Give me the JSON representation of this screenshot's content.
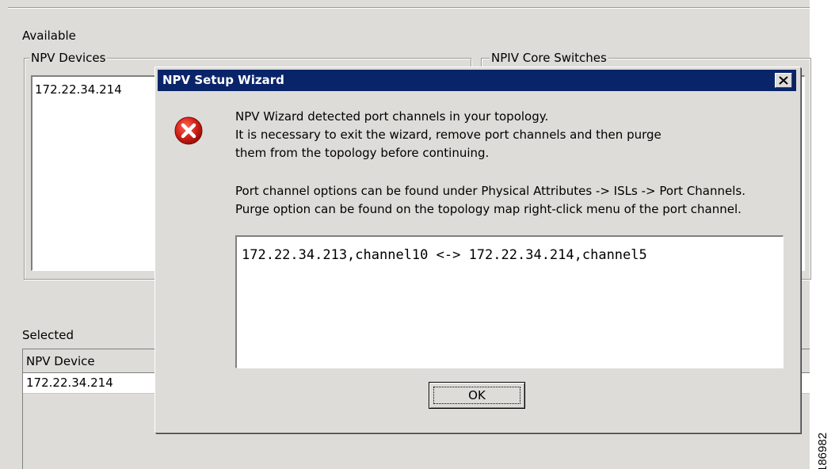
{
  "window": {
    "available_label": "Available",
    "selected_label": "Selected",
    "npv_devices_group": {
      "title": "NPV Devices",
      "items": [
        "172.22.34.214"
      ]
    },
    "npiv_core_group": {
      "title": "NPIV Core Switches"
    },
    "selected_table": {
      "columns": [
        "NPV Device"
      ],
      "rows": [
        [
          "172.22.34.214"
        ]
      ]
    }
  },
  "dialog": {
    "title": "NPV Setup Wizard",
    "close_glyph": "✕",
    "icon": "error-icon",
    "messages": [
      "NPV Wizard detected port channels in your topology.",
      "It is necessary to exit the wizard, remove port channels and then purge",
      "them from the topology before continuing.",
      "Port channel options can be found under Physical Attributes -> ISLs -> Port Channels.",
      "Purge option can be found on the topology map right-click menu of the port channel."
    ],
    "detail": "172.22.34.213,channel10 <-> 172.22.34.214,channel5",
    "ok_label": "OK"
  },
  "figure_id": "186982",
  "colors": {
    "titlebar": "#0a246a",
    "panel": "#dddcd8",
    "error_red": "#cc1111"
  }
}
